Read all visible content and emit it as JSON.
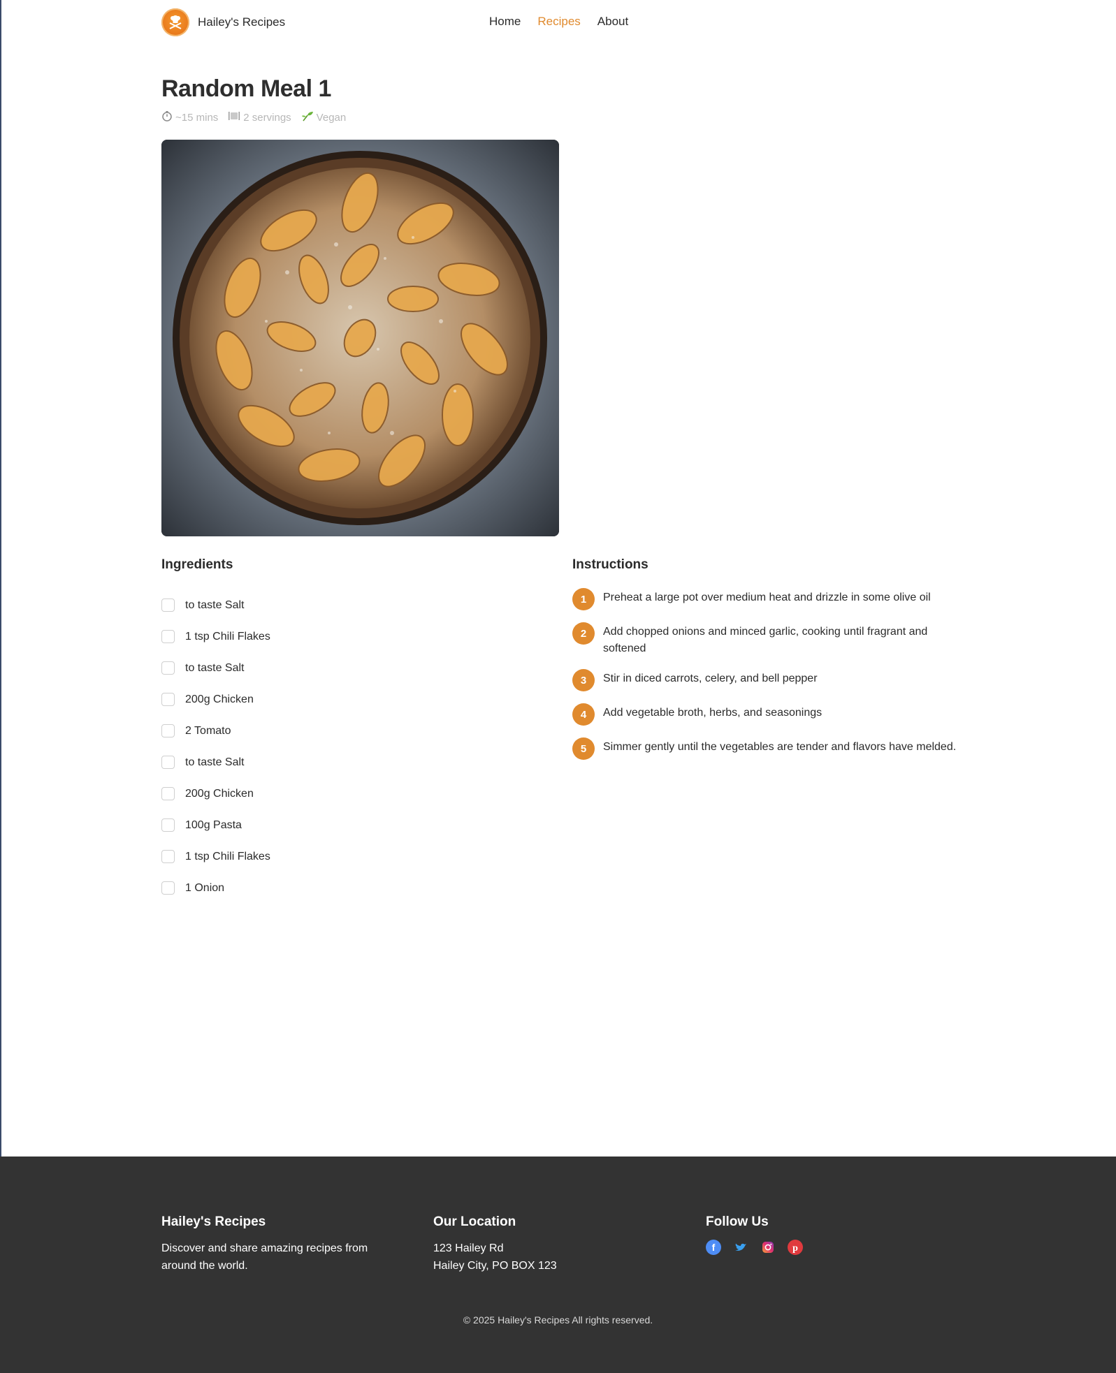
{
  "header": {
    "brand_name": "Hailey's Recipes",
    "nav": [
      {
        "label": "Home",
        "active": false
      },
      {
        "label": "Recipes",
        "active": true
      },
      {
        "label": "About",
        "active": false
      }
    ]
  },
  "recipe": {
    "title": "Random Meal 1",
    "meta": {
      "time": "~15 mins",
      "servings": "2 servings",
      "diet": "Vegan"
    }
  },
  "ingredients": {
    "title": "Ingredients",
    "items": [
      "to taste Salt",
      "1 tsp Chili Flakes",
      "to taste Salt",
      "200g Chicken",
      "2 Tomato",
      "to taste Salt",
      "200g Chicken",
      "100g Pasta",
      "1 tsp Chili Flakes",
      "1 Onion"
    ]
  },
  "instructions": {
    "title": "Instructions",
    "steps": [
      {
        "num": "1",
        "text": "Preheat a large pot over medium heat and drizzle in some olive oil"
      },
      {
        "num": "2",
        "text": "Add chopped onions and minced garlic, cooking until fragrant and softened"
      },
      {
        "num": "3",
        "text": "Stir in diced carrots, celery, and bell pepper"
      },
      {
        "num": "4",
        "text": "Add vegetable broth, herbs, and seasonings"
      },
      {
        "num": "5",
        "text": "Simmer gently until the vegetables are tender and flavors have melded."
      }
    ]
  },
  "footer": {
    "about": {
      "title": "Hailey's Recipes",
      "text": "Discover and share amazing recipes from around the world."
    },
    "location": {
      "title": "Our Location",
      "line1": "123 Hailey Rd",
      "line2": "Hailey City, PO BOX 123"
    },
    "follow": {
      "title": "Follow Us",
      "icons": [
        "facebook-icon",
        "twitter-icon",
        "instagram-icon",
        "pinterest-icon"
      ]
    },
    "copyright": "© 2025 Hailey's Recipes All rights reserved."
  },
  "colors": {
    "accent": "#e08a2e",
    "footer_bg": "#333333",
    "meta_text": "#b7b7b7"
  }
}
